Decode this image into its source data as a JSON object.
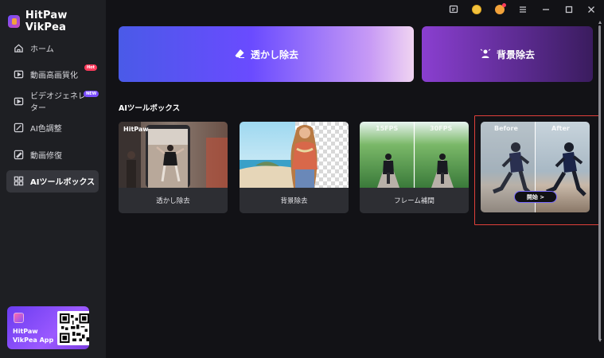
{
  "app": {
    "title": "HitPaw VikPea"
  },
  "sidebar": {
    "items": [
      {
        "label": "ホーム",
        "icon": "home-icon"
      },
      {
        "label": "動画高画質化",
        "icon": "video-enhance-icon",
        "badge": "Hot"
      },
      {
        "label": "ビデオジェネレーター",
        "icon": "video-generator-icon",
        "badge": "NEW"
      },
      {
        "label": "AI色調整",
        "icon": "color-adjust-icon"
      },
      {
        "label": "動画修復",
        "icon": "video-repair-icon"
      },
      {
        "label": "AIツールボックス",
        "icon": "toolbox-icon",
        "active": true
      }
    ],
    "promo": {
      "line1": "HitPaw",
      "line2": "VikPea App"
    }
  },
  "titlebar": {
    "icons": [
      "feedback-icon",
      "coin-icon",
      "account-icon",
      "menu-icon",
      "minimize-icon",
      "maximize-icon",
      "close-icon"
    ]
  },
  "hero": {
    "watermark_label": "透かし除去",
    "background_label": "背景除去"
  },
  "toolbox": {
    "title": "AIツールボックス",
    "cards": [
      {
        "label": "透かし除去",
        "image_text": "HitPaw"
      },
      {
        "label": "背景除去"
      },
      {
        "label": "フレーム補間",
        "left_tag": "15FPS",
        "right_tag": "30FPS"
      },
      {
        "before": "Before",
        "after": "After",
        "button": "開始 >"
      }
    ]
  },
  "colors": {
    "accent": "#6a4bff",
    "selection": "#e0403a",
    "sidebar_bg": "#1e1f23",
    "main_bg": "#121216"
  }
}
